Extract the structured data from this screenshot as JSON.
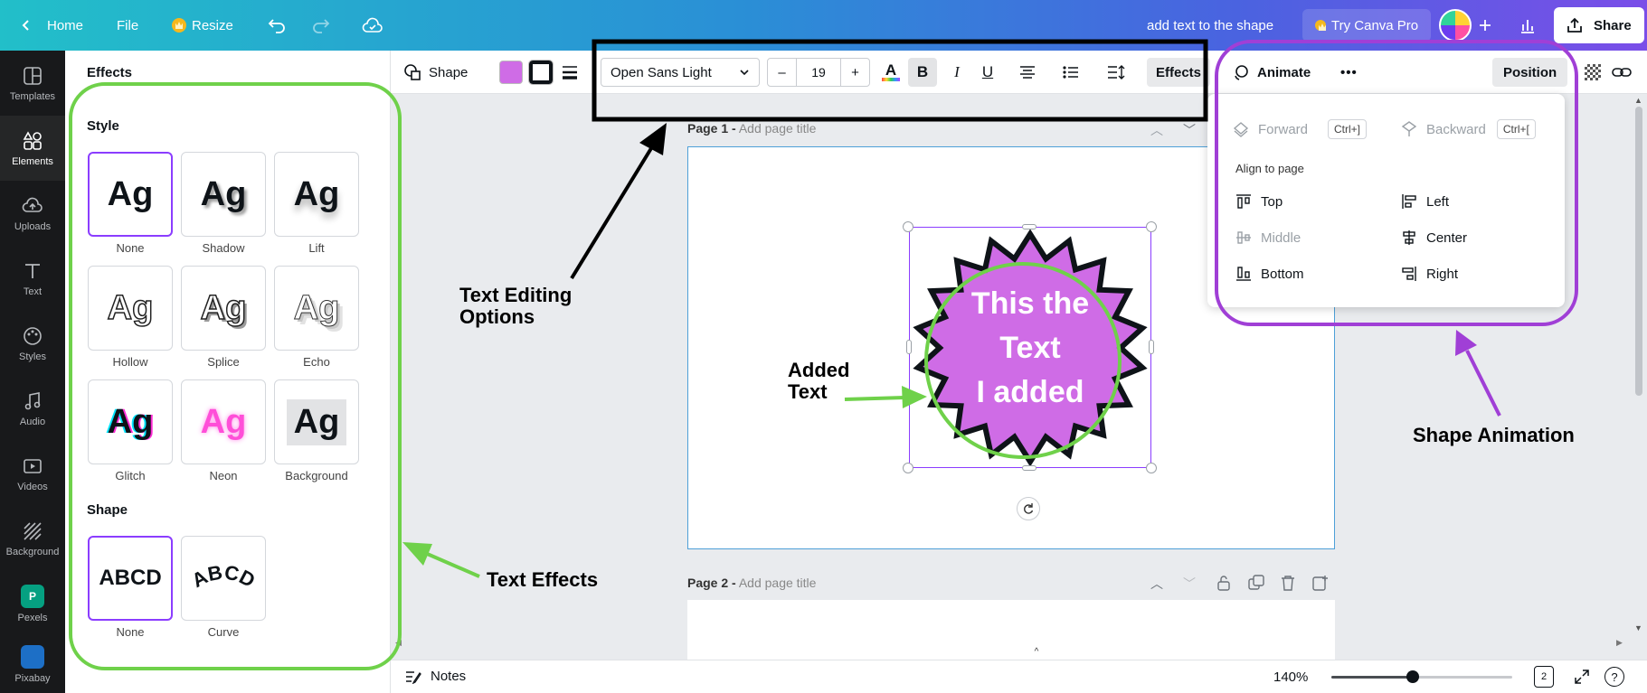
{
  "topbar": {
    "home": "Home",
    "file": "File",
    "resize": "Resize",
    "doc_title": "add text to the shape",
    "try_pro": "Try Canva Pro",
    "share": "Share"
  },
  "rail": {
    "items": [
      {
        "label": "Templates",
        "icon": "templates-icon"
      },
      {
        "label": "Elements",
        "icon": "elements-icon"
      },
      {
        "label": "Uploads",
        "icon": "uploads-icon"
      },
      {
        "label": "Text",
        "icon": "text-icon"
      },
      {
        "label": "Styles",
        "icon": "styles-icon"
      },
      {
        "label": "Audio",
        "icon": "audio-icon"
      },
      {
        "label": "Videos",
        "icon": "videos-icon"
      },
      {
        "label": "Background",
        "icon": "background-icon"
      },
      {
        "label": "Pexels",
        "icon": "pexels-icon"
      },
      {
        "label": "Pixabay",
        "icon": "pixabay-icon"
      }
    ]
  },
  "panel": {
    "title": "Effects",
    "style_title": "Style",
    "style_tile_text": "Ag",
    "styles": [
      "None",
      "Shadow",
      "Lift",
      "Hollow",
      "Splice",
      "Echo",
      "Glitch",
      "Neon",
      "Background"
    ],
    "shape_title": "Shape",
    "shape_tile_text": "ABCD",
    "shapes": [
      "None",
      "Curve"
    ]
  },
  "toolbar": {
    "shape_label": "Shape",
    "fill_color": "#cf6ce6",
    "font": "Open Sans Light",
    "minus": "–",
    "font_size": "19",
    "plus": "+",
    "bold": "B",
    "italic": "I",
    "underline": "U",
    "effects": "Effects",
    "animate": "Animate",
    "more": "•••",
    "position": "Position"
  },
  "pages": {
    "page1_prefix": "Page 1 -",
    "page2_prefix": "Page 2 -",
    "add_title": "Add page title"
  },
  "shape": {
    "fill": "#cf6ce6",
    "line1": "This the",
    "line2": "Text",
    "line3": "I added"
  },
  "position_menu": {
    "forward": "Forward",
    "forward_key": "Ctrl+]",
    "backward": "Backward",
    "backward_key": "Ctrl+[",
    "align_title": "Align to page",
    "top": "Top",
    "left": "Left",
    "middle": "Middle",
    "center": "Center",
    "bottom": "Bottom",
    "right": "Right"
  },
  "bottom": {
    "notes": "Notes",
    "zoom": "140%",
    "page_count": "2",
    "zoom_level": 0.45
  },
  "annotations": {
    "text_editing_1": "Text Editing",
    "text_editing_2": "Options",
    "added_1": "Added",
    "added_2": "Text",
    "text_effects": "Text Effects",
    "shape_animation": "Shape Animation"
  },
  "colors": {
    "accent": "#8b3dff",
    "annotation_green": "#6fd14a",
    "annotation_purple": "#a03fd6"
  }
}
